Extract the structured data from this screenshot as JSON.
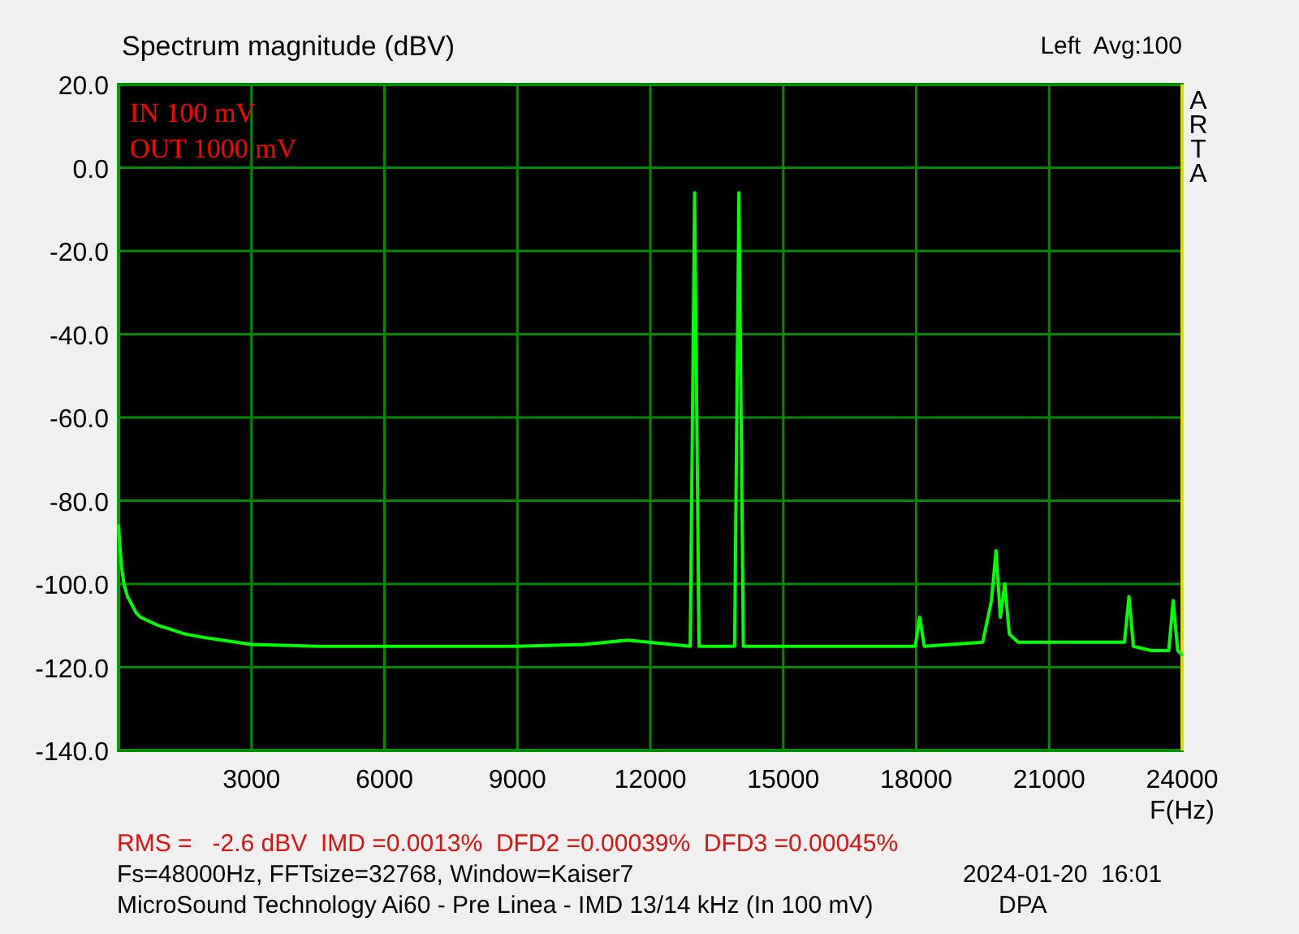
{
  "header": {
    "channel_info": "Left  Avg:100"
  },
  "brand_label": "ARTA",
  "annotations": [
    "IN 100 mV",
    "OUT 1000 mV"
  ],
  "chart_data": {
    "type": "line",
    "grid": true,
    "title": "Spectrum magnitude (dBV)",
    "xlabel": "F(Hz)",
    "xlim": [
      0,
      24000
    ],
    "ylim": [
      -140,
      20
    ],
    "xticks": [
      3000,
      6000,
      9000,
      12000,
      15000,
      18000,
      21000,
      24000
    ],
    "yticks": [
      {
        "value": 20,
        "label": "20.0"
      },
      {
        "value": 0,
        "label": "0.0"
      },
      {
        "value": -20,
        "label": "-20.0"
      },
      {
        "value": -40,
        "label": "-40.0"
      },
      {
        "value": -60,
        "label": "-60.0"
      },
      {
        "value": -80,
        "label": "-80.0"
      },
      {
        "value": -100,
        "label": "-100.0"
      },
      {
        "value": -120,
        "label": "-120.0"
      },
      {
        "value": -140,
        "label": "-140.0"
      }
    ],
    "x": [
      0,
      60,
      120,
      200,
      300,
      400,
      500,
      700,
      900,
      1200,
      1500,
      2000,
      3000,
      4500,
      6000,
      8000,
      9000,
      10500,
      11500,
      12900,
      13000,
      13100,
      13900,
      14000,
      14100,
      16000,
      17980,
      18080,
      18180,
      19500,
      19700,
      19800,
      19900,
      20000,
      20100,
      20300,
      21000,
      22000,
      22700,
      22800,
      22900,
      23300,
      23700,
      23800,
      23900,
      24000
    ],
    "series": [
      {
        "color": "#00ff00",
        "values": [
          -86,
          -95,
          -100,
          -103,
          -105,
          -107,
          -108,
          -109,
          -110,
          -111,
          -112,
          -113,
          -114.5,
          -115,
          -115,
          -115,
          -115,
          -114.5,
          -113.5,
          -115,
          -6,
          -115,
          -115,
          -6,
          -115,
          -115,
          -115,
          -108,
          -115,
          -114,
          -104,
          -92,
          -108,
          -100,
          -112,
          -114,
          -114,
          -114,
          -114,
          -103,
          -115,
          -116,
          -116,
          -104,
          -116,
          -117
        ]
      }
    ]
  },
  "footer": {
    "results": "RMS =   -2.6 dBV  IMD =0.0013%  DFD2 =0.00039%  DFD3 =0.00045%",
    "settings": "Fs=48000Hz, FFTsize=32768, Window=Kaiser7",
    "timestamp": "2024-01-20  16:01",
    "description": "MicroSound Technology Ai60 - Pre Linea - IMD 13/14 kHz (In 100 mV)",
    "tag": "DPA"
  }
}
